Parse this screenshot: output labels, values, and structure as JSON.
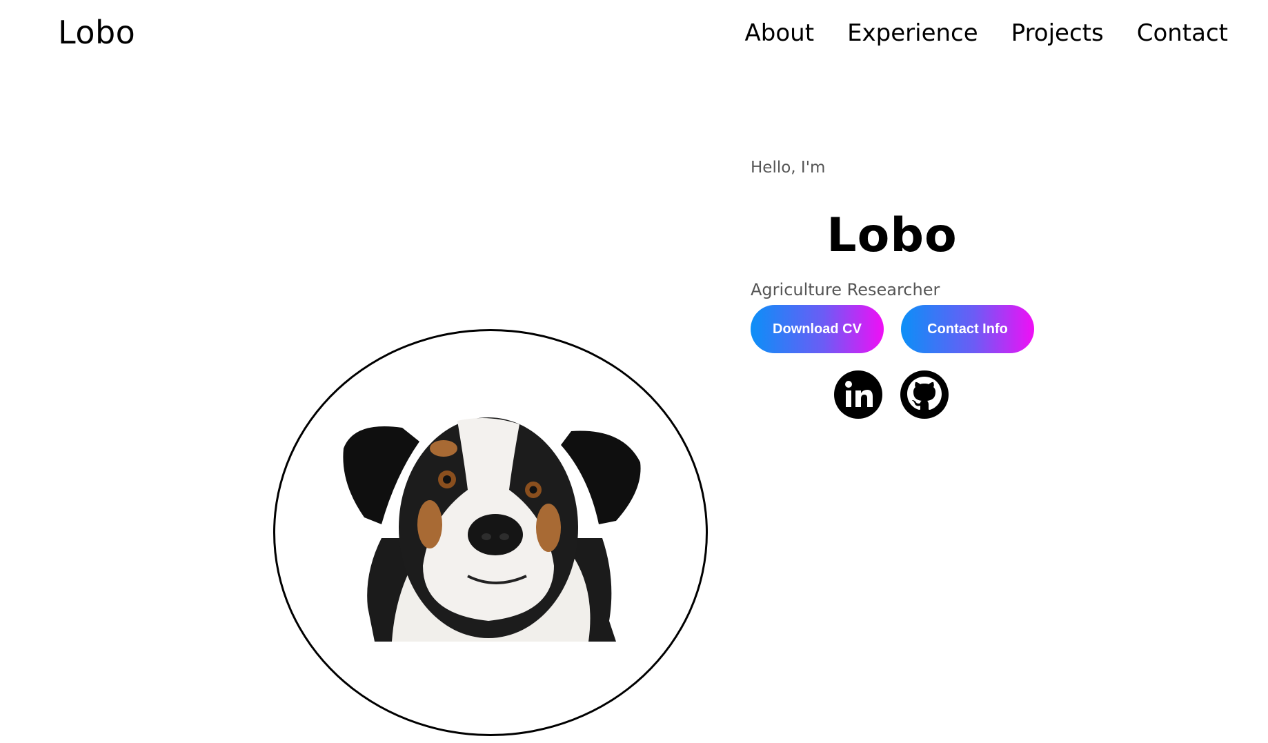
{
  "header": {
    "logo": "Lobo",
    "nav": [
      "About",
      "Experience",
      "Projects",
      "Contact"
    ]
  },
  "profile": {
    "image_icon": "dog-portrait",
    "greeting": "Hello, I'm",
    "name": "Lobo",
    "role": "Agriculture Researcher",
    "buttons": {
      "download_cv": "Download CV",
      "contact_info": "Contact Info"
    },
    "socials": {
      "linkedin_icon": "linkedin-icon",
      "github_icon": "github-icon"
    }
  },
  "colors": {
    "button_gradient_start": "#0c8ff7",
    "button_gradient_end": "#f00ff5",
    "text": "#000000",
    "muted_text": "#555555"
  }
}
